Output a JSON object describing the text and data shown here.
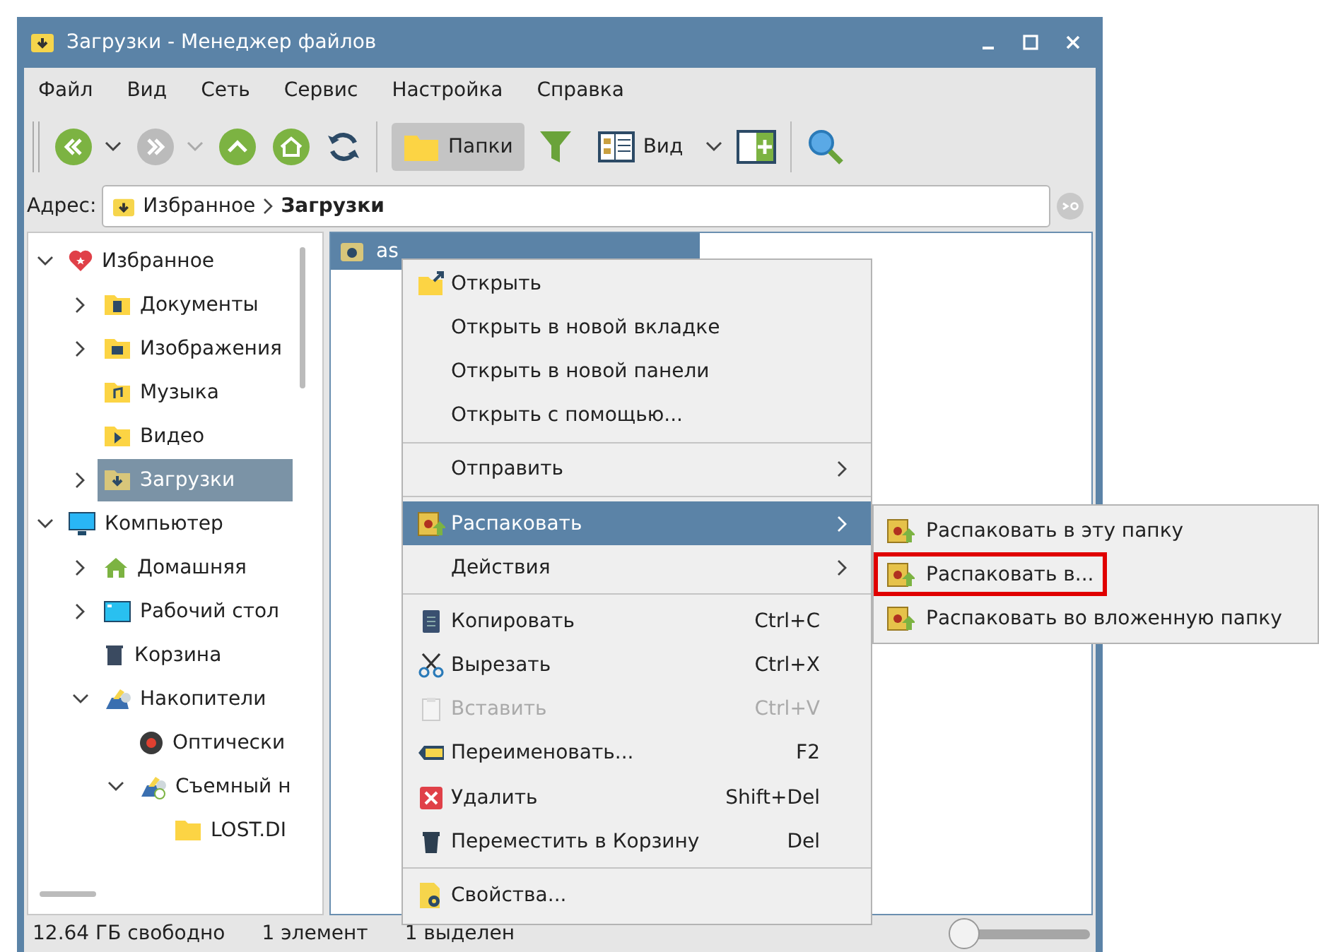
{
  "window": {
    "title": "Загрузки - Менеджер файлов"
  },
  "menubar": [
    "Файл",
    "Вид",
    "Сеть",
    "Сервис",
    "Настройка",
    "Справка"
  ],
  "toolbar": {
    "back_disabled": false,
    "forward_disabled": true,
    "folders_button": {
      "label": "Папки",
      "selected": true
    },
    "view_button": {
      "label": "Вид"
    }
  },
  "address": {
    "label": "Адрес:",
    "path": [
      "Избранное",
      "Загрузки"
    ]
  },
  "tree": [
    {
      "label": "Избранное",
      "expanded": true,
      "selected": false,
      "children": [
        {
          "label": "Документы",
          "expanded": false,
          "selected": false
        },
        {
          "label": "Изображения",
          "expanded": false,
          "selected": false
        },
        {
          "label": "Музыка",
          "selected": false
        },
        {
          "label": "Видео",
          "selected": false
        },
        {
          "label": "Загрузки",
          "expanded": false,
          "selected": true
        }
      ]
    },
    {
      "label": "Компьютер",
      "expanded": true,
      "selected": false,
      "children": [
        {
          "label": "Домашняя",
          "expanded": false,
          "selected": false
        },
        {
          "label": "Рабочий стол",
          "expanded": false,
          "selected": false
        },
        {
          "label": "Корзина",
          "selected": false
        },
        {
          "label": "Накопители",
          "expanded": true,
          "selected": false,
          "children": [
            {
              "label": "Оптически",
              "selected": false
            },
            {
              "label": "Съемный н",
              "expanded": true,
              "selected": false,
              "children": [
                {
                  "label": "LOST.DI",
                  "selected": false
                }
              ]
            }
          ]
        }
      ]
    }
  ],
  "files": [
    {
      "name": "as",
      "selected": true
    }
  ],
  "context_menu": [
    {
      "kind": "item",
      "label": "Открыть",
      "disabled": false,
      "selected": false
    },
    {
      "kind": "item",
      "label": "Открыть в новой вкладке",
      "disabled": false,
      "selected": false
    },
    {
      "kind": "item",
      "label": "Открыть в новой панели",
      "disabled": false,
      "selected": false
    },
    {
      "kind": "item",
      "label": "Открыть с помощью...",
      "disabled": false,
      "selected": false
    },
    {
      "kind": "separator"
    },
    {
      "kind": "submenu",
      "label": "Отправить",
      "disabled": false,
      "selected": false
    },
    {
      "kind": "separator"
    },
    {
      "kind": "submenu",
      "label": "Распаковать",
      "disabled": false,
      "selected": true
    },
    {
      "kind": "submenu",
      "label": "Действия",
      "disabled": false,
      "selected": false
    },
    {
      "kind": "separator"
    },
    {
      "kind": "item",
      "label": "Копировать",
      "shortcut": "Ctrl+C",
      "disabled": false,
      "selected": false
    },
    {
      "kind": "item",
      "label": "Вырезать",
      "shortcut": "Ctrl+X",
      "disabled": false,
      "selected": false
    },
    {
      "kind": "item",
      "label": "Вставить",
      "shortcut": "Ctrl+V",
      "disabled": true,
      "selected": false
    },
    {
      "kind": "item",
      "label": "Переименовать...",
      "shortcut": "F2",
      "disabled": false,
      "selected": false
    },
    {
      "kind": "item",
      "label": "Удалить",
      "shortcut": "Shift+Del",
      "disabled": false,
      "selected": false
    },
    {
      "kind": "item",
      "label": "Переместить в Корзину",
      "shortcut": "Del",
      "disabled": false,
      "selected": false
    },
    {
      "kind": "separator"
    },
    {
      "kind": "item",
      "label": "Свойства...",
      "disabled": false,
      "selected": false
    }
  ],
  "submenu": [
    {
      "label": "Распаковать в эту папку",
      "marked": false
    },
    {
      "label": "Распаковать в...",
      "marked": true
    },
    {
      "label": "Распаковать во вложенную папку",
      "marked": false
    }
  ],
  "status_bar": {
    "free": "12.64 ГБ свободно",
    "count": "1 элемент",
    "selected": "1 выделен",
    "zoom": {
      "level": 0
    }
  }
}
